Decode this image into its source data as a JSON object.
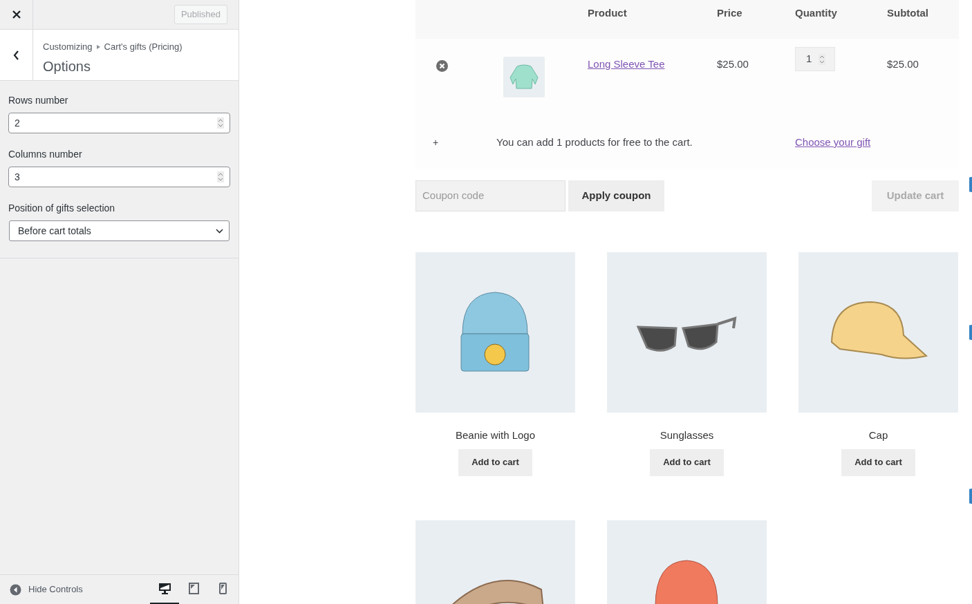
{
  "header": {
    "publish_button": {
      "label": "Published",
      "disabled": true
    }
  },
  "breadcrumb": {
    "path": "Customizing",
    "section": "Cart's gifts (Pricing)",
    "title": "Options"
  },
  "controls": [
    {
      "kind": "number",
      "label": "Rows number",
      "value": "2"
    },
    {
      "kind": "number",
      "label": "Columns number",
      "value": "3"
    },
    {
      "kind": "select",
      "label": "Position of gifts selection",
      "value": "Before cart totals"
    }
  ],
  "footer": {
    "hide_controls": "Hide Controls",
    "devices": [
      {
        "kind": "desktop",
        "selected": true
      },
      {
        "kind": "tablet",
        "selected": false
      },
      {
        "kind": "mobile",
        "selected": false
      }
    ]
  },
  "cart": {
    "columns": [
      "Product",
      "Price",
      "Quantity",
      "Subtotal"
    ],
    "rows": [
      {
        "product": "Long Sleeve Tee",
        "price": "$25.00",
        "quantity": "1",
        "subtotal": "$25.00"
      }
    ],
    "gift_row": {
      "icon": "+",
      "text": "You can add 1 products for free to the cart.",
      "link": "Choose your gift"
    },
    "coupon_placeholder": "Coupon code",
    "apply_button": "Apply coupon",
    "update_button": {
      "label": "Update cart",
      "disabled": true
    }
  },
  "gifts": [
    {
      "name": "Beanie with Logo",
      "button": "Add to cart"
    },
    {
      "name": "Sunglasses",
      "button": "Add to cart"
    },
    {
      "name": "Cap",
      "button": "Add to cart"
    },
    {
      "kind": "picture"
    },
    {
      "kind": "picture"
    }
  ]
}
